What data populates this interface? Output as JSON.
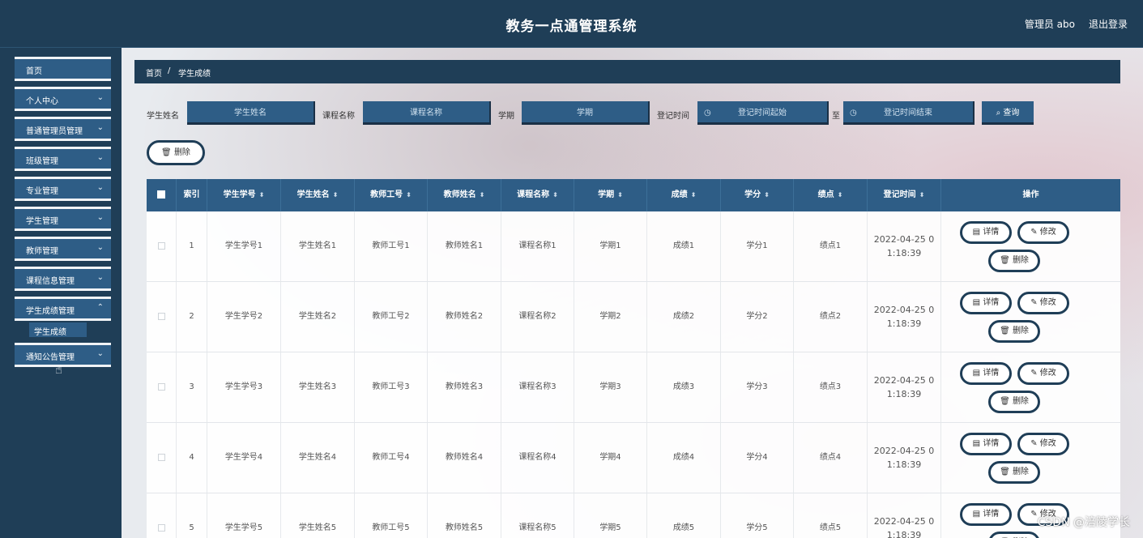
{
  "header": {
    "title": "教务一点通管理系统",
    "user": "管理员 abo",
    "logout": "退出登录"
  },
  "sidebar": {
    "items": [
      {
        "label": "首页",
        "chevron": ""
      },
      {
        "label": "个人中心",
        "chevron": "⌄"
      },
      {
        "label": "普通管理员管理",
        "chevron": "⌄"
      },
      {
        "label": "班级管理",
        "chevron": "⌄"
      },
      {
        "label": "专业管理",
        "chevron": "⌄"
      },
      {
        "label": "学生管理",
        "chevron": "⌄"
      },
      {
        "label": "教师管理",
        "chevron": "⌄"
      },
      {
        "label": "课程信息管理",
        "chevron": "⌄"
      },
      {
        "label": "学生成绩管理",
        "chevron": "⌃"
      },
      {
        "label": "通知公告管理",
        "chevron": "⌄"
      }
    ],
    "subitem": "学生成绩"
  },
  "breadcrumb": {
    "home": "首页",
    "sep": "/",
    "current": "学生成绩"
  },
  "search": {
    "student_name_label": "学生姓名",
    "student_name_placeholder": "学生姓名",
    "course_label": "课程名称",
    "course_placeholder": "课程名称",
    "term_label": "学期",
    "term_placeholder": "学期",
    "time_label": "登记时间",
    "time_start_placeholder": "登记时间起始",
    "to_label": "至",
    "time_end_placeholder": "登记时间结束",
    "query_button": "查询"
  },
  "batch_delete": "删除",
  "table": {
    "headers": [
      "索引",
      "学生学号",
      "学生姓名",
      "教师工号",
      "教师姓名",
      "课程名称",
      "学期",
      "成绩",
      "学分",
      "绩点",
      "登记时间",
      "操作"
    ],
    "rows": [
      {
        "index": "1",
        "student_no": "学生学号1",
        "student_name": "学生姓名1",
        "teacher_no": "教师工号1",
        "teacher_name": "教师姓名1",
        "course": "课程名称1",
        "term": "学期1",
        "score": "成绩1",
        "credit": "学分1",
        "gpa": "绩点1",
        "time_a": "2022-04-25 0",
        "time_b": "1:18:39"
      },
      {
        "index": "2",
        "student_no": "学生学号2",
        "student_name": "学生姓名2",
        "teacher_no": "教师工号2",
        "teacher_name": "教师姓名2",
        "course": "课程名称2",
        "term": "学期2",
        "score": "成绩2",
        "credit": "学分2",
        "gpa": "绩点2",
        "time_a": "2022-04-25 0",
        "time_b": "1:18:39"
      },
      {
        "index": "3",
        "student_no": "学生学号3",
        "student_name": "学生姓名3",
        "teacher_no": "教师工号3",
        "teacher_name": "教师姓名3",
        "course": "课程名称3",
        "term": "学期3",
        "score": "成绩3",
        "credit": "学分3",
        "gpa": "绩点3",
        "time_a": "2022-04-25 0",
        "time_b": "1:18:39"
      },
      {
        "index": "4",
        "student_no": "学生学号4",
        "student_name": "学生姓名4",
        "teacher_no": "教师工号4",
        "teacher_name": "教师姓名4",
        "course": "课程名称4",
        "term": "学期4",
        "score": "成绩4",
        "credit": "学分4",
        "gpa": "绩点4",
        "time_a": "2022-04-25 0",
        "time_b": "1:18:39"
      },
      {
        "index": "5",
        "student_no": "学生学号5",
        "student_name": "学生姓名5",
        "teacher_no": "教师工号5",
        "teacher_name": "教师姓名5",
        "course": "课程名称5",
        "term": "学期5",
        "score": "成绩5",
        "credit": "学分5",
        "gpa": "绩点5",
        "time_a": "2022-04-25 0",
        "time_b": "1:18:39"
      }
    ],
    "actions": {
      "detail": "详情",
      "edit": "修改",
      "delete": "删除"
    }
  },
  "watermark": "CSDN @涪陵学长",
  "colors": {
    "navy": "#1f3e57",
    "blue": "#2e5d86"
  }
}
